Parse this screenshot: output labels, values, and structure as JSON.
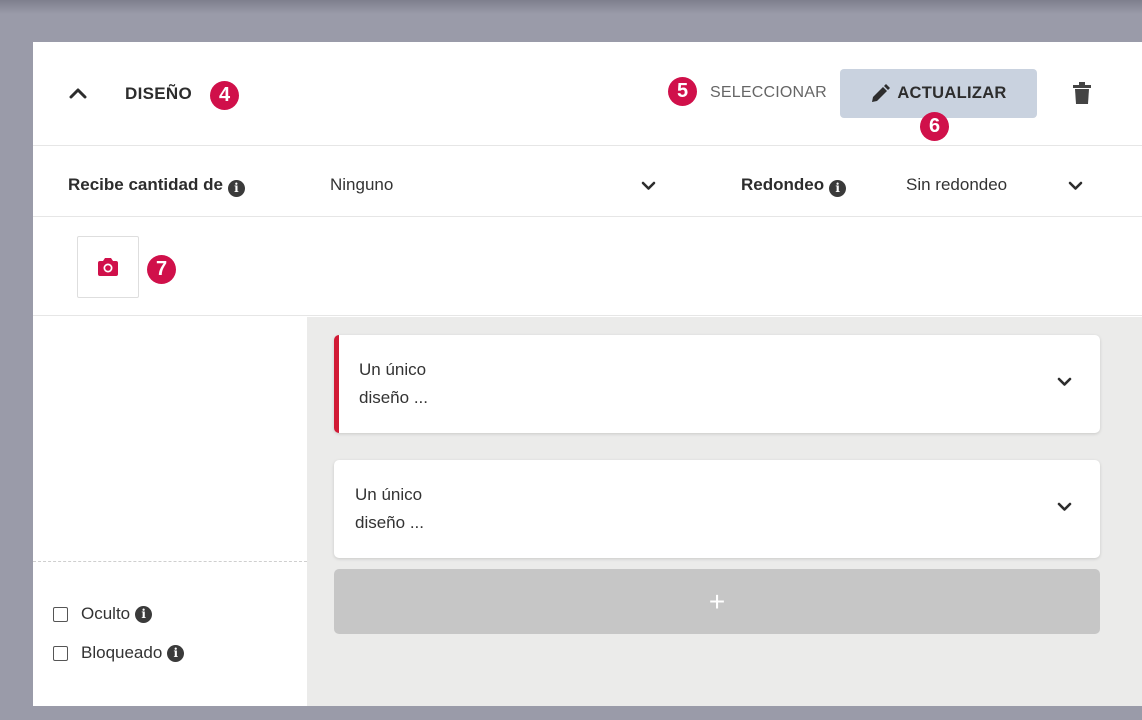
{
  "section": {
    "title": "DISEÑO",
    "select_label": "SELECCIONAR",
    "update_label": "ACTUALIZAR"
  },
  "badges": {
    "b4": "4",
    "b5": "5",
    "b6": "6",
    "b7": "7"
  },
  "fields": {
    "receives_label": "Recibe cantidad de",
    "receives_value": "Ninguno",
    "rounding_label": "Redondeo",
    "rounding_value": "Sin redondeo"
  },
  "info_glyph": "i",
  "items": [
    {
      "text": "Un único\ndiseño ...",
      "active": true
    },
    {
      "text": "Un único\ndiseño ...",
      "active": false
    }
  ],
  "add_label": "+",
  "checkboxes": {
    "hidden_label": "Oculto",
    "locked_label": "Bloqueado"
  },
  "colors": {
    "accent": "#d0104a",
    "active_border": "#d11a35",
    "update_button": "#c9d2df",
    "add_button": "#c6c6c6"
  },
  "icons": [
    "chevron-up-icon",
    "pencil-icon",
    "trash-icon",
    "info-icon",
    "chevron-down-icon",
    "camera-icon",
    "plus-icon"
  ]
}
